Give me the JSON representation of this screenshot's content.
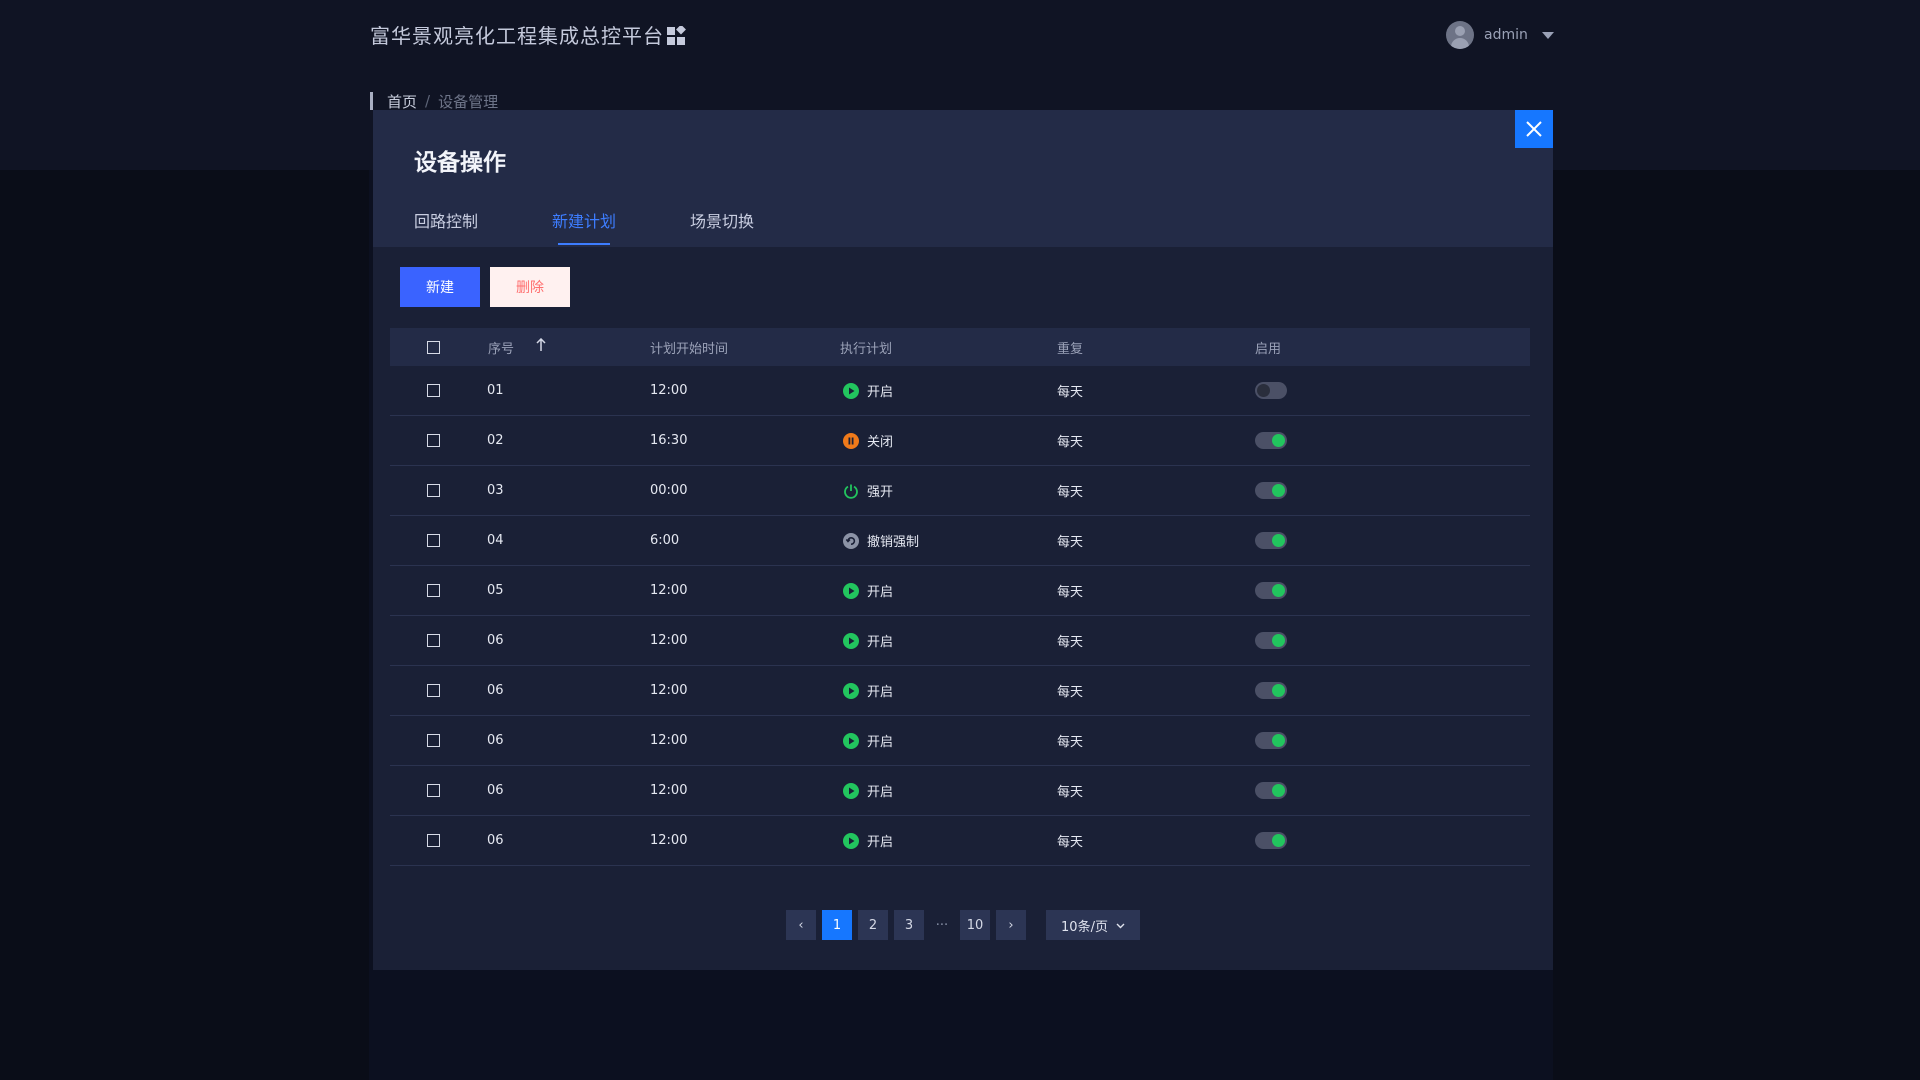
{
  "app": {
    "title": "富华景观亮化工程集成总控平台"
  },
  "user": {
    "name": "admin"
  },
  "breadcrumb": {
    "home": "首页",
    "separator": "/",
    "current": "设备管理"
  },
  "modal": {
    "title": "设备操作",
    "tabs": [
      {
        "label": "回路控制",
        "active": false
      },
      {
        "label": "新建计划",
        "active": true
      },
      {
        "label": "场景切换",
        "active": false
      }
    ],
    "buttons": {
      "new": "新建",
      "delete": "删除"
    }
  },
  "table": {
    "headers": {
      "seq": "序号",
      "start_time": "计划开始时间",
      "plan": "执行计划",
      "repeat": "重复",
      "enabled": "启用"
    },
    "rows": [
      {
        "seq": "01",
        "time": "12:00",
        "plan": "开启",
        "plan_icon": "play-icon",
        "repeat": "每天",
        "enabled": false
      },
      {
        "seq": "02",
        "time": "16:30",
        "plan": "关闭",
        "plan_icon": "pause-icon",
        "repeat": "每天",
        "enabled": true
      },
      {
        "seq": "03",
        "time": "00:00",
        "plan": "强开",
        "plan_icon": "power-icon",
        "repeat": "每天",
        "enabled": true
      },
      {
        "seq": "04",
        "time": "6:00",
        "plan": "撤销强制",
        "plan_icon": "undo-icon",
        "repeat": "每天",
        "enabled": true
      },
      {
        "seq": "05",
        "time": "12:00",
        "plan": "开启",
        "plan_icon": "play-icon",
        "repeat": "每天",
        "enabled": true
      },
      {
        "seq": "06",
        "time": "12:00",
        "plan": "开启",
        "plan_icon": "play-icon",
        "repeat": "每天",
        "enabled": true
      },
      {
        "seq": "06",
        "time": "12:00",
        "plan": "开启",
        "plan_icon": "play-icon",
        "repeat": "每天",
        "enabled": true
      },
      {
        "seq": "06",
        "time": "12:00",
        "plan": "开启",
        "plan_icon": "play-icon",
        "repeat": "每天",
        "enabled": true
      },
      {
        "seq": "06",
        "time": "12:00",
        "plan": "开启",
        "plan_icon": "play-icon",
        "repeat": "每天",
        "enabled": true
      },
      {
        "seq": "06",
        "time": "12:00",
        "plan": "开启",
        "plan_icon": "play-icon",
        "repeat": "每天",
        "enabled": true
      }
    ]
  },
  "pagination": {
    "prev": "‹",
    "pages": [
      "1",
      "2",
      "3"
    ],
    "current": "1",
    "ellipsis": "···",
    "last": "10",
    "next": "›",
    "page_size": "10条/页"
  },
  "colors": {
    "accent": "#1677ff",
    "primary_button": "#3a63ff",
    "toggle_on": "#22c55e",
    "play": "#22c55e",
    "pause": "#f07a1a",
    "undo": "#8c93a6"
  }
}
